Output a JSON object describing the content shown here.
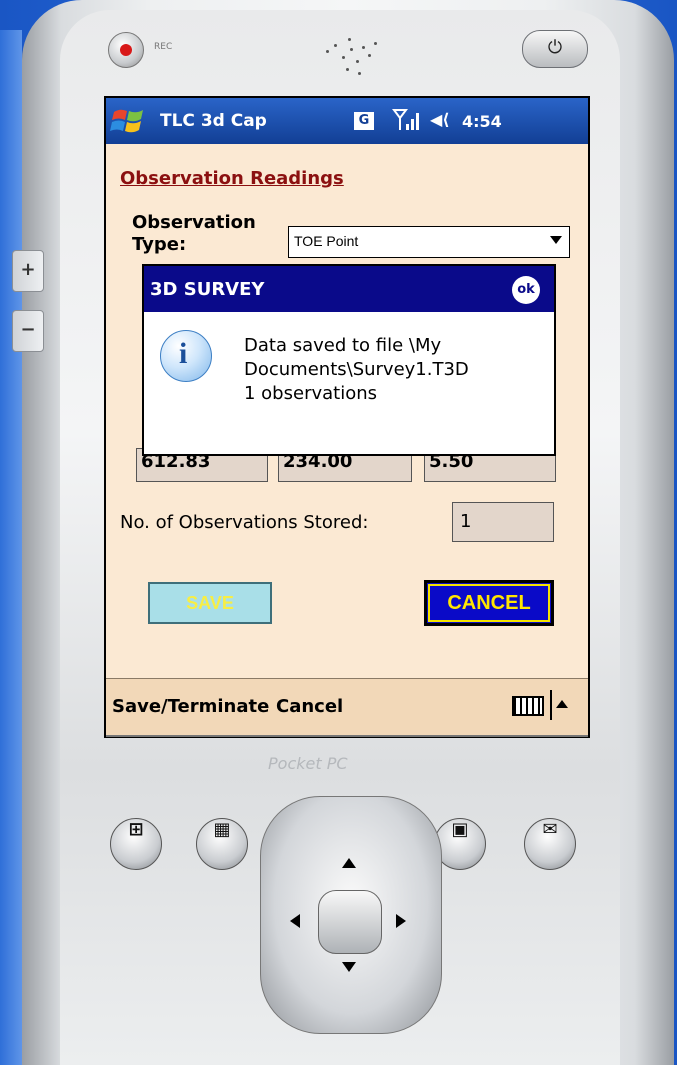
{
  "device": {
    "rec_label": "REC",
    "brand": "Pocket PC",
    "side_plus": "+",
    "side_minus": "−"
  },
  "statusbar": {
    "app_title": "TLC 3d Cap",
    "g_label": "G",
    "time": "4:54"
  },
  "form": {
    "section_title": "Observation Readings",
    "observation_type_label": "Observation Type:",
    "observation_type_value": "TOE Point",
    "coordinates": [
      "612.83",
      "234.00",
      "5.50"
    ],
    "stored_label": "No. of Observations Stored:",
    "stored_value": "1",
    "save_label": "SAVE",
    "cancel_label": "CANCEL"
  },
  "dialog": {
    "title": "3D SURVEY",
    "ok_label": "ok",
    "message_line1": "Data saved to file \\My",
    "message_line2": "Documents\\Survey1.T3D",
    "message_line3": "1 observations"
  },
  "menubar": {
    "left": "Save/Terminate",
    "right": "Cancel"
  },
  "colors": {
    "content_bg": "#fbe9d3",
    "title_bar": "#123f95",
    "dialog_title_bar": "#0a0a8a",
    "cancel_button": "#0a0ac8",
    "save_button": "#a9dfe8",
    "section_title": "#8b1010"
  },
  "icons": [
    "windows-start-icon",
    "g-icon",
    "signal-icon",
    "volume-icon",
    "info-icon",
    "keyboard-icon",
    "power-icon",
    "record-icon",
    "windows-hw-icon",
    "calendar-icon",
    "contacts-icon",
    "mail-icon"
  ]
}
